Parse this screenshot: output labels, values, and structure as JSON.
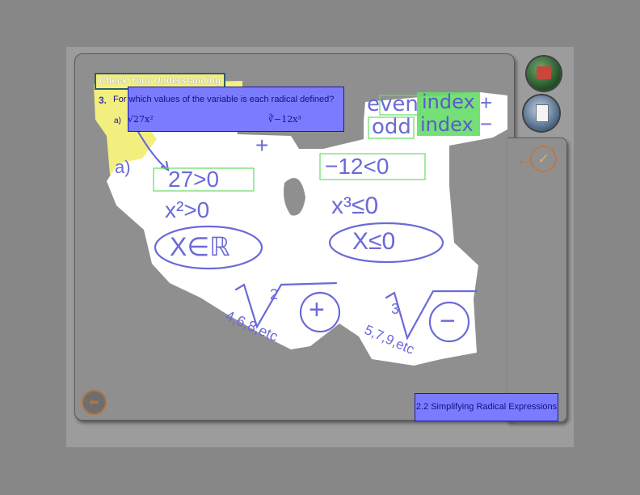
{
  "check_understanding": {
    "label": "Check Your Understanding"
  },
  "question": {
    "number": "3.",
    "text": "For which values of the variable is each radical defined?",
    "part_a_label": "a)",
    "part_a_radicand": "√27x²",
    "part_b_radicand": "∛−12x³"
  },
  "handwriting": {
    "even": "even",
    "odd": "odd",
    "index_even": "index",
    "index_odd": "index",
    "plus_sign": "+",
    "minus_sign": "−",
    "plus_below": "+",
    "label_a": "a)",
    "eq_a1": "27>0",
    "eq_a2": "x²>0",
    "eq_a3": "X∈ℝ",
    "eq_b1": "−12<0",
    "eq_b2": "x³≤0",
    "eq_b3": "X≤0",
    "even_index_note": "2",
    "even_values": "4,6,8,etc",
    "even_result": "+",
    "odd_index_note": "3",
    "odd_values": "5,7,9,etc",
    "odd_result": "−"
  },
  "footer": {
    "title": "2.2 Simplifying Radical Expressions"
  },
  "colors": {
    "ink": "#6a6ad8",
    "highlight": "#f3ef7e",
    "selection": "#7b7bff",
    "green": "#66dd66"
  },
  "icons": {
    "home": "home-icon",
    "notes": "notes-icon",
    "check": "check-icon",
    "back": "back-arrow-icon",
    "prev": "prev-arrow-icon"
  }
}
